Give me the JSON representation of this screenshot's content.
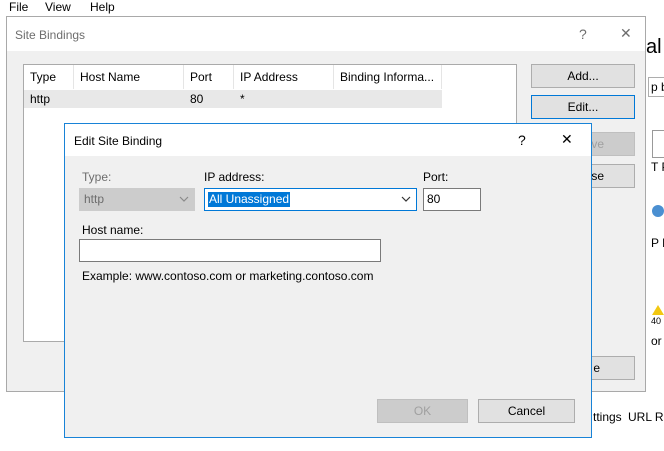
{
  "menu": {
    "file": "File",
    "view": "View",
    "help": "Help"
  },
  "background": {
    "fragments": [
      "al",
      "p b",
      "T P",
      "P E",
      "40",
      "or P",
      "ttings",
      "URL Re"
    ],
    "partial_buttons": [
      "ve",
      "se",
      "e"
    ]
  },
  "site_bindings": {
    "title": "Site Bindings",
    "help_glyph": "?",
    "close_glyph": "✕",
    "columns": [
      "Type",
      "Host Name",
      "Port",
      "IP Address",
      "Binding Informa..."
    ],
    "rows": [
      {
        "type": "http",
        "host_name": "",
        "port": "80",
        "ip_address": "*",
        "binding_info": ""
      }
    ],
    "buttons": {
      "add": "Add...",
      "edit": "Edit..."
    }
  },
  "edit_binding": {
    "title": "Edit Site Binding",
    "help_glyph": "?",
    "close_glyph": "✕",
    "type_label": "Type:",
    "type_value": "http",
    "ip_label": "IP address:",
    "ip_value": "All Unassigned",
    "port_label": "Port:",
    "port_value": "80",
    "host_label": "Host name:",
    "host_value": "",
    "example": "Example: www.contoso.com or marketing.contoso.com",
    "ok_label": "OK",
    "cancel_label": "Cancel"
  },
  "colors": {
    "accent": "#0078d7",
    "dialog_bg": "#f0f0f0",
    "button_bg": "#e1e1e1"
  }
}
